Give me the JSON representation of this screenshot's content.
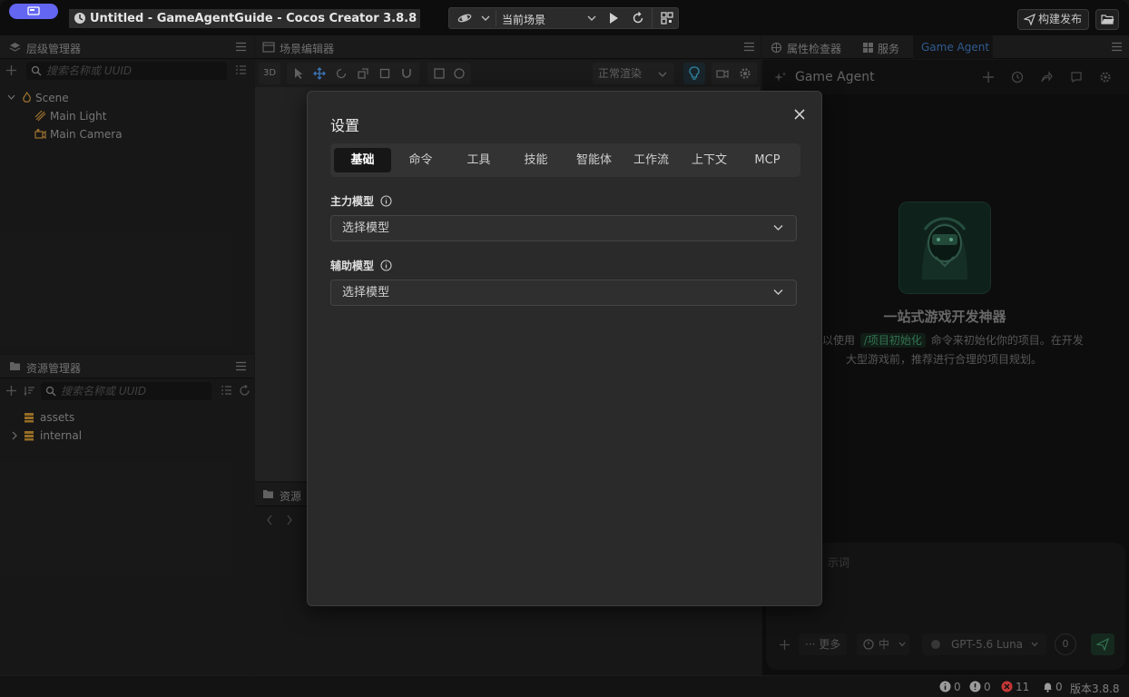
{
  "window": {
    "title": "Untitled - GameAgentGuide - Cocos Creator 3.8.8",
    "scene_select": "当前场景",
    "build_button": "构建发布"
  },
  "hierarchy": {
    "title": "层级管理器",
    "search_placeholder": "搜索名称或 UUID",
    "items": [
      "Scene",
      "Main Light",
      "Main Camera"
    ]
  },
  "assets": {
    "title": "资源管理器",
    "search_placeholder": "搜索名称或 UUID",
    "items": [
      "assets",
      "internal"
    ]
  },
  "scene_editor": {
    "title": "场景编辑器",
    "mode_3d": "3D",
    "render_mode": "正常渲染",
    "preview_tab": "资源"
  },
  "right_tabs": [
    "属性检查器",
    "服务",
    "Game Agent"
  ],
  "agent": {
    "title": "Game Agent",
    "hero_title": "一站式游戏开发神器",
    "hero_desc_prefix": "以使用",
    "hero_cmd": "/项目初始化",
    "hero_desc_suffix": "命令来初始化你的项目。在开发",
    "hero_desc_line2": "大型游戏前，推荐进行合理的项目规划。",
    "input_placeholder": "示词",
    "more": "更多",
    "effort": "中",
    "model": "GPT-5.6 Luna",
    "count": "0"
  },
  "modal": {
    "title": "设置",
    "tabs": [
      "基础",
      "命令",
      "工具",
      "技能",
      "智能体",
      "工作流",
      "上下文",
      "MCP"
    ],
    "active_tab": 0,
    "main_model_label": "主力模型",
    "main_model_value": "选择模型",
    "aux_model_label": "辅助模型",
    "aux_model_value": "选择模型"
  },
  "status": {
    "info": "0",
    "warn": "0",
    "error": "11",
    "bell": "0",
    "version": "版本3.8.8"
  },
  "colors": {
    "accent": "#6366f1",
    "cmd_green": "#4ade80",
    "error": "#ef4444"
  }
}
